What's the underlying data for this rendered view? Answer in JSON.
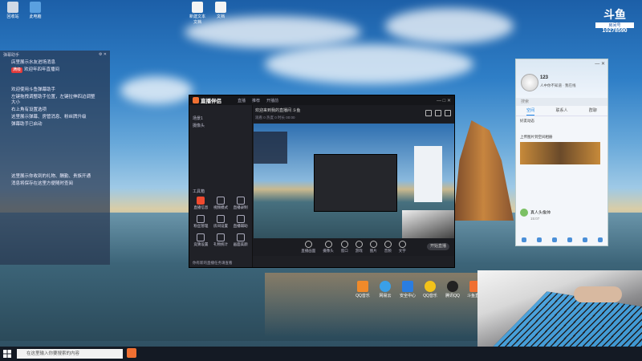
{
  "douyu": {
    "title": "斗鱼",
    "subtitle": "房间号",
    "room_id": "10278590"
  },
  "left_panel": {
    "header": "弹幕助手",
    "lines": [
      {
        "badge": "",
        "text": "店里展示水友进场消息"
      },
      {
        "badge": "满级",
        "text": "欢迎年四年直播间"
      },
      {
        "badge": "",
        "text": "欢迎使用斗鱼弹幕助手"
      },
      {
        "badge": "",
        "text": "左键拖拽调整助手位置，左键拉伸四边调整大小"
      },
      {
        "badge": "",
        "text": "右上角有设置选项"
      },
      {
        "badge": "",
        "text": "这里展示弹幕、房管消息、粉丝牌升级"
      },
      {
        "badge": "",
        "text": "弹幕助手已启动"
      },
      {
        "badge": "",
        "text": "这里展示你收到的礼物、酬勤、贵族开通"
      },
      {
        "badge": "",
        "text": "消息将保存在这里方便随时查阅"
      }
    ]
  },
  "app": {
    "title": "直播伴侣",
    "tabs": [
      "直播",
      "推荐",
      "开播前"
    ],
    "header_line1": "欢迎来到我的直播间 斗鱼",
    "header_line2": "观看 0  热度 0  时长 00:00",
    "sidebar_items": [
      "场景1",
      "摄像头"
    ],
    "tools_header": "工具箱",
    "tools": [
      "直播信息",
      "视频模式",
      "直播录制",
      "粉丝管理",
      "房间设置",
      "直播辅助",
      "竞猜设置",
      "礼物统计",
      "画面美颜"
    ],
    "sidebar_footer": "你有新的直播任务请查看",
    "controls": [
      "直播画面",
      "摄像头",
      "窗口",
      "游戏",
      "图片",
      "音频",
      "文字"
    ],
    "go_live": "开始直播"
  },
  "qq": {
    "name": "123",
    "status": "人中你不知道 · 我在线",
    "search_placeholder": "搜索",
    "tabs": [
      "空间",
      "联系人",
      "群聊"
    ],
    "feed_title": "好友动态",
    "feed_text": "上传图片到空间相册",
    "chat_name": "真人头像帅",
    "chat_time": "15:07"
  },
  "desktop_icons": [
    "回收站",
    "此电脑",
    "新建文本文档",
    "文档",
    "QQ音乐",
    "网易云",
    "安全中心",
    "QQ音乐",
    "腾讯QQ",
    "斗鱼直播"
  ],
  "taskbar": {
    "search_placeholder": "在这里输入你要搜索的内容"
  }
}
